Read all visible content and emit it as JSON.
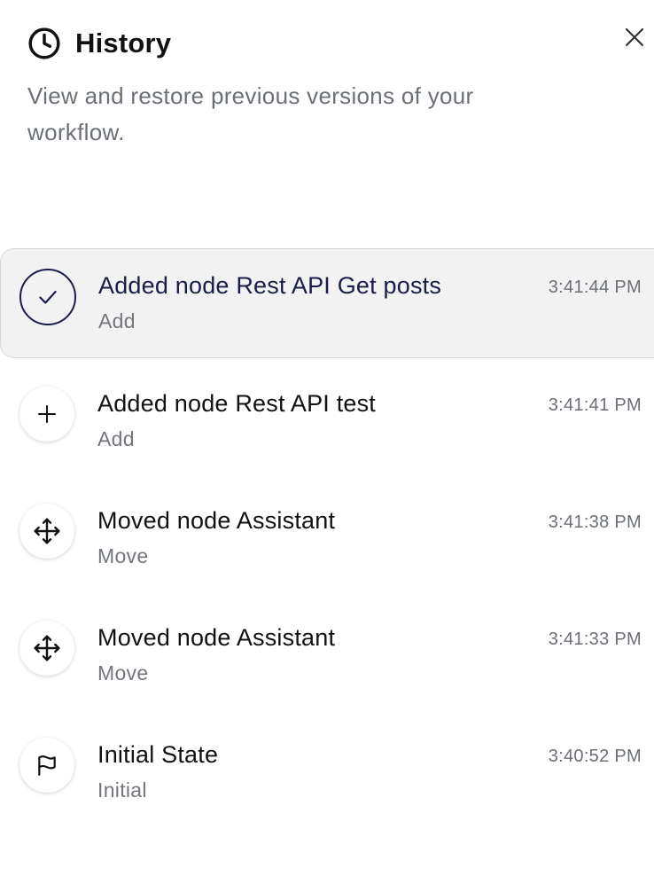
{
  "header": {
    "title": "History",
    "icon": "clock-icon",
    "subtitle": "View and restore previous versions of your workflow.",
    "close_icon": "close-icon"
  },
  "colors": {
    "selected_accent": "#1a1d4a",
    "selected_bg": "#f2f2f3",
    "muted_text": "#6b6f77"
  },
  "history": [
    {
      "title": "Added node Rest API Get posts",
      "type": "Add",
      "time": "3:41:44 PM",
      "icon": "check-icon",
      "selected": true
    },
    {
      "title": "Added node Rest API test",
      "type": "Add",
      "time": "3:41:41 PM",
      "icon": "plus-icon",
      "selected": false
    },
    {
      "title": "Moved node Assistant",
      "type": "Move",
      "time": "3:41:38 PM",
      "icon": "move-icon",
      "selected": false
    },
    {
      "title": "Moved node Assistant",
      "type": "Move",
      "time": "3:41:33 PM",
      "icon": "move-icon",
      "selected": false
    },
    {
      "title": "Initial State",
      "type": "Initial",
      "time": "3:40:52 PM",
      "icon": "flag-icon",
      "selected": false
    }
  ]
}
